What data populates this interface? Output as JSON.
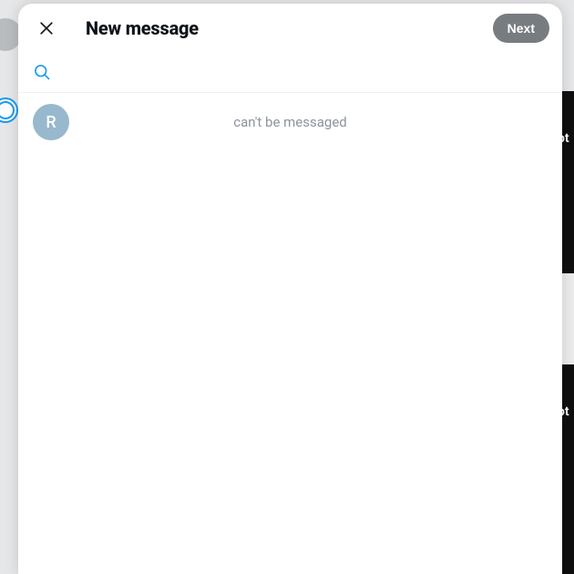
{
  "header": {
    "title": "New message",
    "next_label": "Next"
  },
  "search": {
    "value": "",
    "placeholder": ""
  },
  "results": [
    {
      "avatar_initial": "R",
      "status_text": "can't be messaged"
    }
  ],
  "background": {
    "right_text_1": "ot",
    "right_text_2": "ot"
  }
}
